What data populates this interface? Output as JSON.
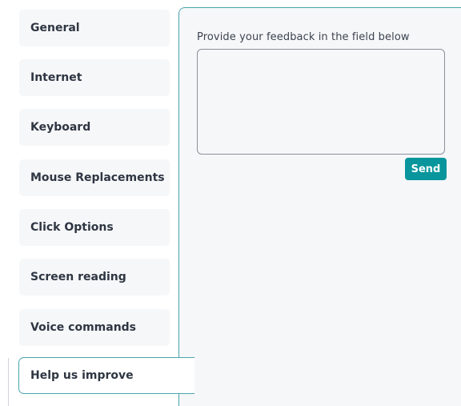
{
  "sidebar": {
    "items": [
      {
        "label": "General"
      },
      {
        "label": "Internet"
      },
      {
        "label": "Keyboard"
      },
      {
        "label": "Mouse Replacements"
      },
      {
        "label": "Click Options"
      },
      {
        "label": "Screen reading"
      },
      {
        "label": "Voice commands"
      },
      {
        "label": "Help us improve",
        "active": true
      }
    ]
  },
  "feedback": {
    "prompt": "Provide your feedback in the field below",
    "value": "",
    "send_label": "Send"
  },
  "colors": {
    "accent": "#08969c",
    "border_accent": "#49a7ae",
    "item_background": "#f6f7f9",
    "text": "#2e3642"
  }
}
